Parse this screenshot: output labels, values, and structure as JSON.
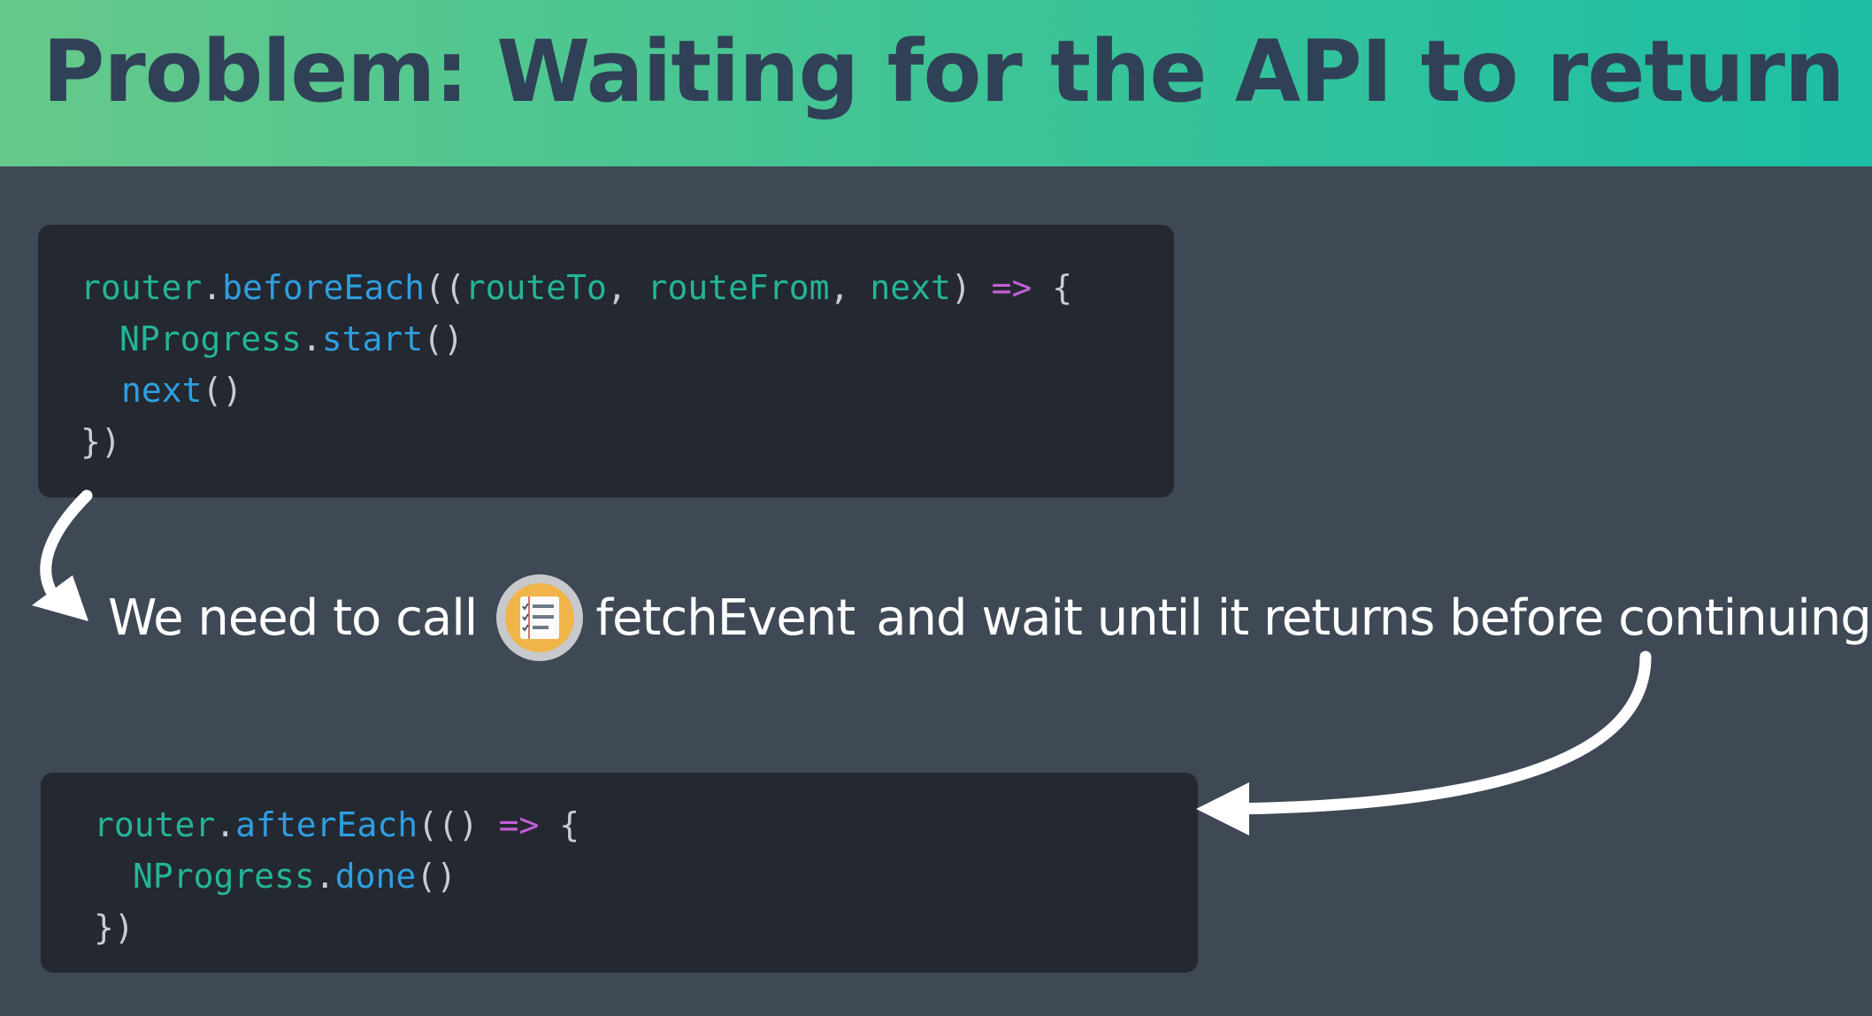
{
  "title": "Problem: Waiting for the API to return",
  "code_before_each": {
    "line1": {
      "obj": "router",
      "dot": ".",
      "fn": "beforeEach",
      "open": "((",
      "p1": "routeTo",
      "c1": ", ",
      "p2": "routeFrom",
      "c2": ", ",
      "p3": "next",
      "close": ") ",
      "arrow": "=>",
      "brace": " {"
    },
    "line2": {
      "obj": "NProgress",
      "dot": ".",
      "fn": "start",
      "parens": "()"
    },
    "line3": {
      "fn": "next",
      "parens": "()"
    },
    "line4": "})"
  },
  "sentence": {
    "part1": "We need to call",
    "function_name": "fetchEvent",
    "part2": "and wait until it returns before continuing",
    "icon": "checklist-icon"
  },
  "code_after_each": {
    "line1": {
      "obj": "router",
      "dot": ".",
      "fn": "afterEach",
      "open": "(()",
      "arrow": "=>",
      "space_before_arrow": " ",
      "brace": " {"
    },
    "line2": {
      "obj": "NProgress",
      "dot": ".",
      "fn": "done",
      "parens": "()"
    },
    "line3": "})"
  },
  "colors": {
    "header_gradient_start": "#66c98a",
    "header_gradient_end": "#1cbfa5",
    "title_text": "#304157",
    "background": "#3f4855",
    "code_background": "#242830",
    "code_identifier": "#23b597",
    "code_function": "#2f9ee0",
    "code_arrow": "#c45ed8",
    "code_punctuation": "#c9ccd2"
  }
}
